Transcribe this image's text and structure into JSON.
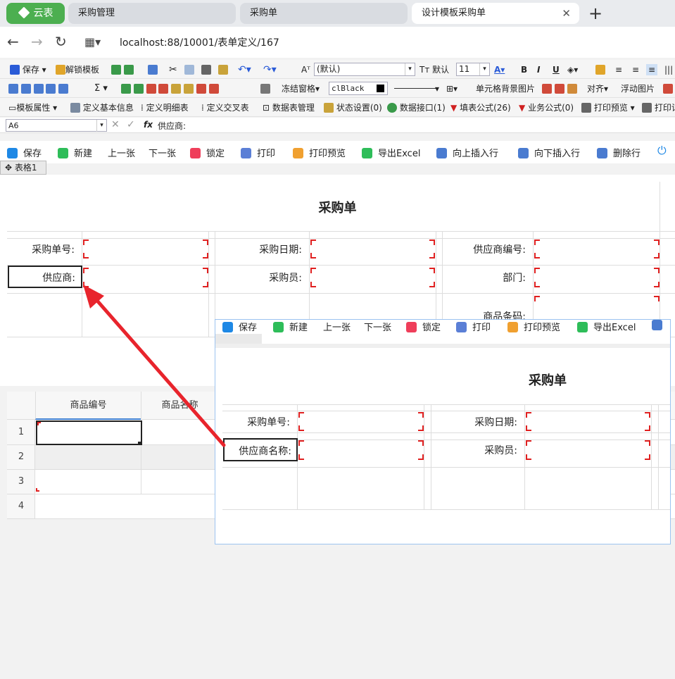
{
  "app": {
    "brand": "云表"
  },
  "tabs": [
    {
      "label": "采购管理"
    },
    {
      "label": "采购单"
    },
    {
      "label": "设计模板采购单"
    }
  ],
  "address": {
    "url": "localhost:88/10001/表单定义/167"
  },
  "toolbar1": {
    "save": "保存",
    "unlock": "解锁模板",
    "font_name": "(默认)",
    "default_font": "默认",
    "font_size": "11",
    "bold": "B",
    "italic": "I",
    "underline": "U"
  },
  "toolbar2": {
    "sum": "Σ",
    "freeze": "冻结窗格",
    "color_name": "clBlack",
    "cell_bg": "单元格背景图片",
    "align": "对齐",
    "float_img": "浮动图片"
  },
  "toolbar3": {
    "template_props": "模板属性",
    "define_basic": "定义基本信息",
    "define_detail": "定义明细表",
    "define_cross": "定义交叉表",
    "data_mgmt": "数据表管理",
    "status": "状态设置(0)",
    "data_api": "数据接口(1)",
    "fill_formula": "填表公式(26)",
    "biz_formula": "业务公式(0)",
    "print_preview": "打印预览",
    "print_more": "打印记"
  },
  "formula_bar": {
    "cell_ref": "A6",
    "fx": "fx",
    "content": "供应商:"
  },
  "actions": {
    "save": "保存",
    "new": "新建",
    "prev": "上一张",
    "next": "下一张",
    "lock": "锁定",
    "print": "打印",
    "print_preview": "打印预览",
    "export": "导出Excel",
    "insert_up": "向上插入行",
    "insert_down": "向下插入行",
    "delete_row": "删除行"
  },
  "sheet_tab": {
    "label": "表格1"
  },
  "form": {
    "title": "采购单",
    "order_no": "采购单号:",
    "order_date": "采购日期:",
    "supplier_no": "供应商编号:",
    "supplier": "供应商:",
    "buyer": "采购员:",
    "dept": "部门:",
    "barcode": "商品条码:"
  },
  "grid": {
    "headers": [
      "商品编号",
      "商品名称"
    ],
    "rows": [
      "1",
      "2",
      "3",
      "4"
    ]
  },
  "overlay": {
    "actions": {
      "save": "保存",
      "new": "新建",
      "prev": "上一张",
      "next": "下一张",
      "lock": "锁定",
      "print": "打印",
      "print_preview": "打印预览",
      "export": "导出Excel"
    },
    "title": "采购单",
    "order_no": "采购单号:",
    "order_date": "采购日期:",
    "supplier_name": "供应商名称:",
    "buyer": "采购员:"
  },
  "colors": {
    "brand": "#4caf50",
    "accent": "#1e88e5",
    "marker": "#e02020",
    "arrow": "#e8242c"
  }
}
